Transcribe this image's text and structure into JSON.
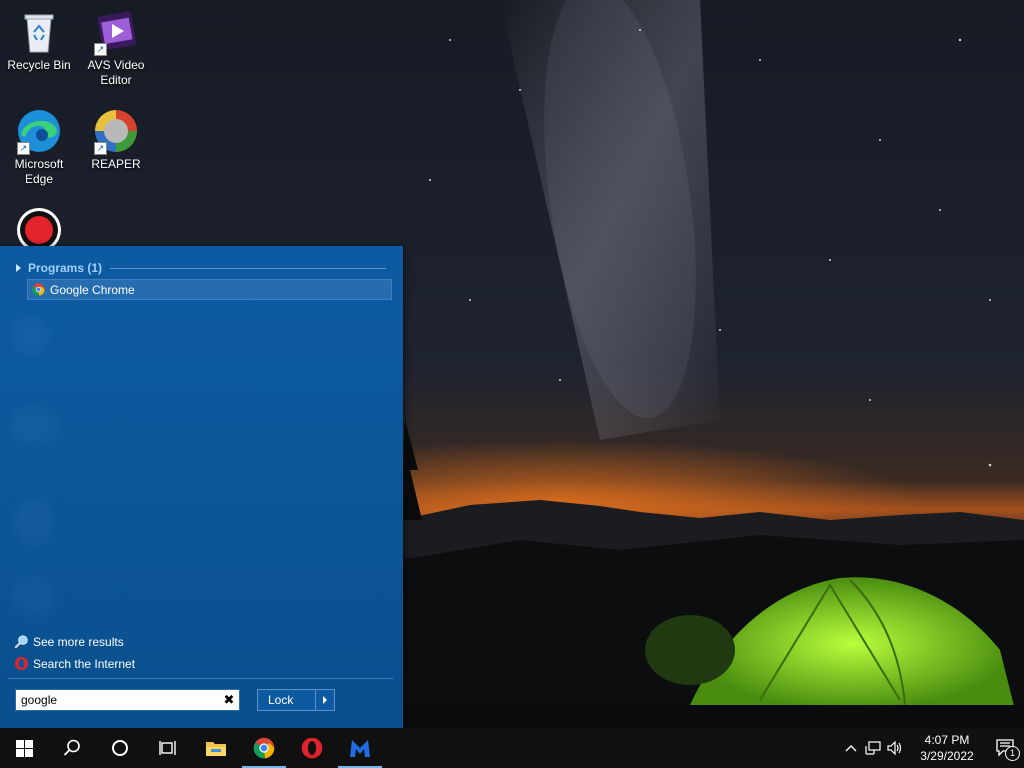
{
  "desktop": {
    "icons": [
      {
        "label": "Recycle Bin",
        "icon": "recycle-bin-icon"
      },
      {
        "label": "AVS Video Editor",
        "icon": "avs-video-editor-icon"
      },
      {
        "label": "Microsoft Edge",
        "icon": "edge-icon"
      },
      {
        "label": "REAPER",
        "icon": "reaper-icon"
      },
      {
        "label": "",
        "icon": "record-icon"
      }
    ]
  },
  "start_menu": {
    "group_label": "Programs (1)",
    "results": [
      {
        "label": "Google Chrome",
        "icon": "chrome-icon"
      }
    ],
    "see_more": "See more results",
    "search_internet": "Search the Internet",
    "search": {
      "value": "google",
      "placeholder": ""
    },
    "lock_label": "Lock"
  },
  "taskbar": {
    "buttons": [
      {
        "name": "start",
        "icon": "windows-logo-icon"
      },
      {
        "name": "search",
        "icon": "search-icon"
      },
      {
        "name": "cortana",
        "icon": "cortana-circle-icon"
      },
      {
        "name": "task-view",
        "icon": "task-view-icon"
      },
      {
        "name": "file-explorer",
        "icon": "folder-icon"
      },
      {
        "name": "chrome",
        "icon": "chrome-icon"
      },
      {
        "name": "opera",
        "icon": "opera-icon"
      },
      {
        "name": "malwarebytes",
        "icon": "malwarebytes-icon"
      }
    ],
    "clock": {
      "time": "4:07 PM",
      "date": "3/29/2022"
    },
    "notification_count": "1"
  },
  "colors": {
    "start_menu_bg": "#0b5597",
    "taskbar_bg": "#101010",
    "accent": "#76b9ed"
  }
}
